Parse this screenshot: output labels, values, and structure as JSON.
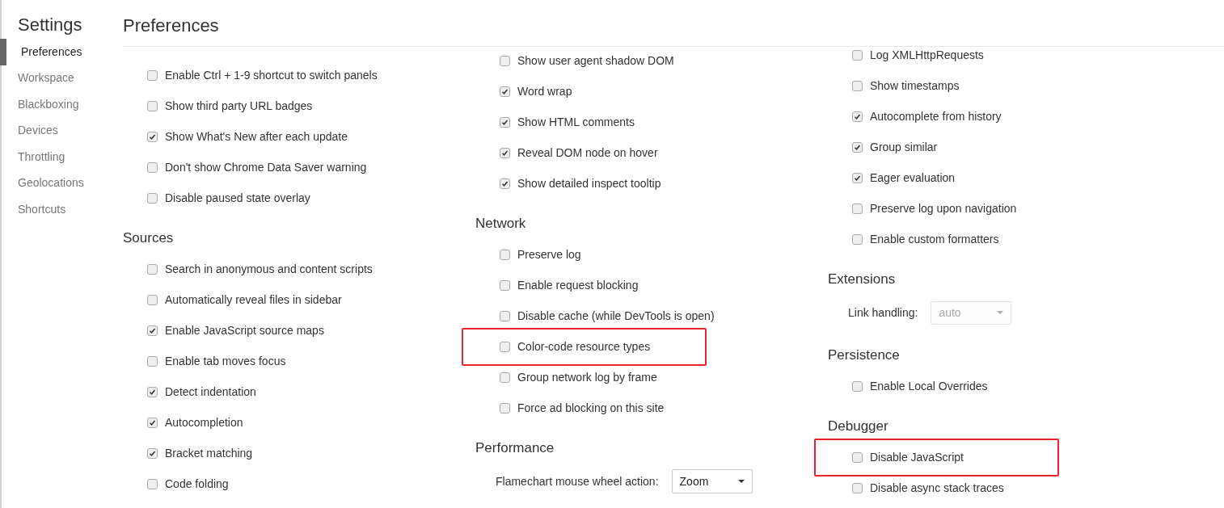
{
  "sidebar": {
    "title": "Settings",
    "items": [
      {
        "label": "Preferences",
        "selected": true
      },
      {
        "label": "Workspace",
        "selected": false
      },
      {
        "label": "Blackboxing",
        "selected": false
      },
      {
        "label": "Devices",
        "selected": false
      },
      {
        "label": "Throttling",
        "selected": false
      },
      {
        "label": "Geolocations",
        "selected": false
      },
      {
        "label": "Shortcuts",
        "selected": false
      }
    ]
  },
  "page_title": "Preferences",
  "columns": [
    {
      "sections": [
        {
          "items": [
            {
              "kind": "checkbox",
              "label": "Enable Ctrl + 1-9 shortcut to switch panels",
              "checked": false,
              "highlighted": false
            },
            {
              "kind": "checkbox",
              "label": "Show third party URL badges",
              "checked": false,
              "highlighted": false
            },
            {
              "kind": "checkbox",
              "label": "Show What's New after each update",
              "checked": true,
              "highlighted": false
            },
            {
              "kind": "checkbox",
              "label": "Don't show Chrome Data Saver warning",
              "checked": false,
              "highlighted": false
            },
            {
              "kind": "checkbox",
              "label": "Disable paused state overlay",
              "checked": false,
              "highlighted": false
            }
          ]
        },
        {
          "title": "Sources",
          "items": [
            {
              "kind": "checkbox",
              "label": "Search in anonymous and content scripts",
              "checked": false,
              "highlighted": false
            },
            {
              "kind": "checkbox",
              "label": "Automatically reveal files in sidebar",
              "checked": false,
              "highlighted": false
            },
            {
              "kind": "checkbox",
              "label": "Enable JavaScript source maps",
              "checked": true,
              "highlighted": false
            },
            {
              "kind": "checkbox",
              "label": "Enable tab moves focus",
              "checked": false,
              "highlighted": false
            },
            {
              "kind": "checkbox",
              "label": "Detect indentation",
              "checked": true,
              "highlighted": false
            },
            {
              "kind": "checkbox",
              "label": "Autocompletion",
              "checked": true,
              "highlighted": false
            },
            {
              "kind": "checkbox",
              "label": "Bracket matching",
              "checked": true,
              "highlighted": false
            },
            {
              "kind": "checkbox",
              "label": "Code folding",
              "checked": false,
              "highlighted": false
            }
          ]
        }
      ]
    },
    {
      "sections": [
        {
          "items": [
            {
              "kind": "checkbox",
              "label": "Show user agent shadow DOM",
              "checked": false,
              "highlighted": false
            },
            {
              "kind": "checkbox",
              "label": "Word wrap",
              "checked": true,
              "highlighted": false
            },
            {
              "kind": "checkbox",
              "label": "Show HTML comments",
              "checked": true,
              "highlighted": false
            },
            {
              "kind": "checkbox",
              "label": "Reveal DOM node on hover",
              "checked": true,
              "highlighted": false
            },
            {
              "kind": "checkbox",
              "label": "Show detailed inspect tooltip",
              "checked": true,
              "highlighted": false
            }
          ]
        },
        {
          "title": "Network",
          "items": [
            {
              "kind": "checkbox",
              "label": "Preserve log",
              "checked": false,
              "highlighted": false
            },
            {
              "kind": "checkbox",
              "label": "Enable request blocking",
              "checked": false,
              "highlighted": false
            },
            {
              "kind": "checkbox",
              "label": "Disable cache (while DevTools is open)",
              "checked": false,
              "highlighted": false
            },
            {
              "kind": "checkbox",
              "label": "Color-code resource types",
              "checked": false,
              "highlighted": true
            },
            {
              "kind": "checkbox",
              "label": "Group network log by frame",
              "checked": false,
              "highlighted": false
            },
            {
              "kind": "checkbox",
              "label": "Force ad blocking on this site",
              "checked": false,
              "highlighted": false
            }
          ]
        },
        {
          "title": "Performance",
          "items": [
            {
              "kind": "select",
              "label": "Flamechart mouse wheel action:",
              "value": "Zoom",
              "disabled": false
            }
          ]
        }
      ]
    },
    {
      "sections": [
        {
          "items": [
            {
              "kind": "checkbox",
              "label": "Log XMLHttpRequests",
              "checked": false,
              "highlighted": false
            },
            {
              "kind": "checkbox",
              "label": "Show timestamps",
              "checked": false,
              "highlighted": false
            },
            {
              "kind": "checkbox",
              "label": "Autocomplete from history",
              "checked": true,
              "highlighted": false
            },
            {
              "kind": "checkbox",
              "label": "Group similar",
              "checked": true,
              "highlighted": false
            },
            {
              "kind": "checkbox",
              "label": "Eager evaluation",
              "checked": true,
              "highlighted": false
            },
            {
              "kind": "checkbox",
              "label": "Preserve log upon navigation",
              "checked": false,
              "highlighted": false
            },
            {
              "kind": "checkbox",
              "label": "Enable custom formatters",
              "checked": false,
              "highlighted": false
            }
          ]
        },
        {
          "title": "Extensions",
          "items": [
            {
              "kind": "select",
              "label": "Link handling:",
              "value": "auto",
              "disabled": true
            }
          ]
        },
        {
          "title": "Persistence",
          "items": [
            {
              "kind": "checkbox",
              "label": "Enable Local Overrides",
              "checked": false,
              "highlighted": false
            }
          ]
        },
        {
          "title": "Debugger",
          "items": [
            {
              "kind": "checkbox",
              "label": "Disable JavaScript",
              "checked": false,
              "highlighted": true
            },
            {
              "kind": "checkbox",
              "label": "Disable async stack traces",
              "checked": false,
              "highlighted": false
            }
          ]
        }
      ]
    }
  ]
}
